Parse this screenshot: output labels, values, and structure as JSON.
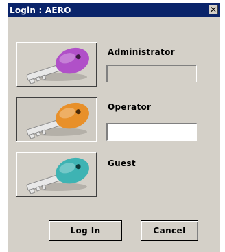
{
  "window": {
    "title": "Login : AERO",
    "close_label": "✕"
  },
  "roles": [
    {
      "name": "Administrator",
      "key_color": "#b050c8",
      "key_icon": "key-icon",
      "password": "",
      "field_enabled": false
    },
    {
      "name": "Operator",
      "key_color": "#e8902a",
      "key_icon": "key-icon",
      "password": "",
      "field_enabled": true,
      "selected": true
    },
    {
      "name": "Guest",
      "key_color": "#3eb3b3",
      "key_icon": "key-icon"
    }
  ],
  "buttons": {
    "login_label": "Log In",
    "cancel_label": "Cancel"
  },
  "colors": {
    "title_bar": "#0a246a",
    "dialog_bg": "#d4d0c8"
  }
}
